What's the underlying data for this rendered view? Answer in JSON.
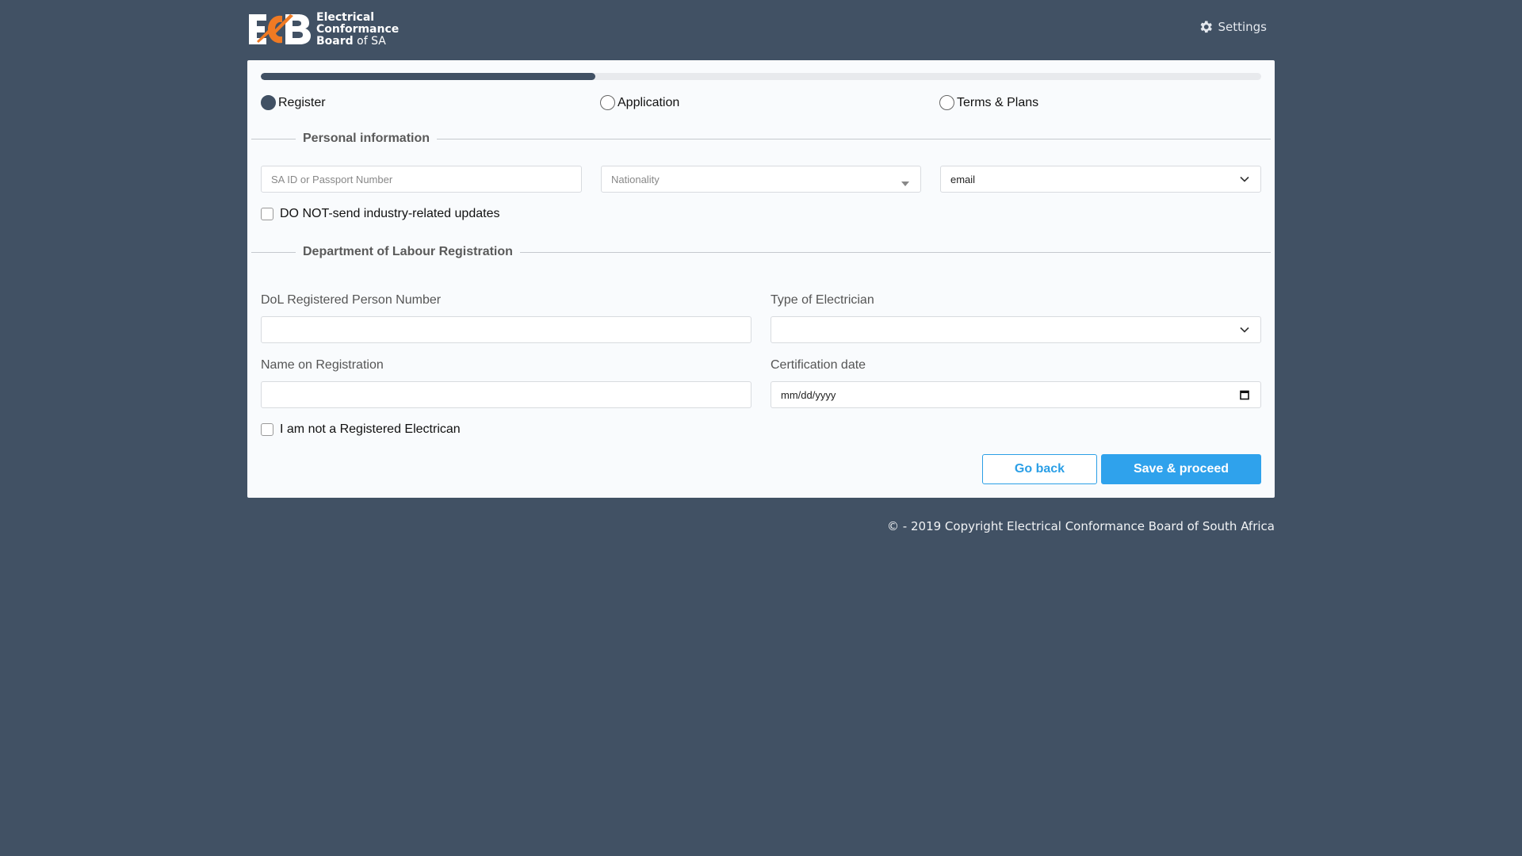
{
  "header": {
    "logo_letters": "ECB",
    "logo_line1": "Electrical",
    "logo_line2": "Conformance",
    "logo_line3_bold": "Board",
    "logo_line3_light": " of SA",
    "settings_label": "Settings"
  },
  "progress": {
    "percent": 33.4
  },
  "steps": [
    {
      "label": "Register",
      "active": true
    },
    {
      "label": "Application",
      "active": false
    },
    {
      "label": "Terms & Plans",
      "active": false
    }
  ],
  "personal": {
    "legend": "Personal information",
    "id_placeholder": "SA ID or Passport Number",
    "nationality_placeholder": "Nationality",
    "contact_method_value": "email",
    "no_updates_label": "DO NOT-send industry-related updates"
  },
  "dol": {
    "legend": "Department of Labour Registration",
    "person_number_label": "DoL Registered Person Number",
    "person_number_value": "",
    "type_label": "Type of Electrician",
    "type_value": "",
    "name_label": "Name on Registration",
    "name_value": "",
    "cert_date_label": "Certification date",
    "cert_date_placeholder": "mm/dd/yyyy",
    "not_registered_label": "I am not a Registered Electrican"
  },
  "actions": {
    "back_label": "Go back",
    "save_label": "Save & proceed"
  },
  "footer": {
    "copyright": "© - 2019 Copyright Electrical Conformance Board of South Africa"
  },
  "colors": {
    "background": "#415164",
    "accent": "#2fa2ec",
    "logo_orange": "#f07a23"
  }
}
